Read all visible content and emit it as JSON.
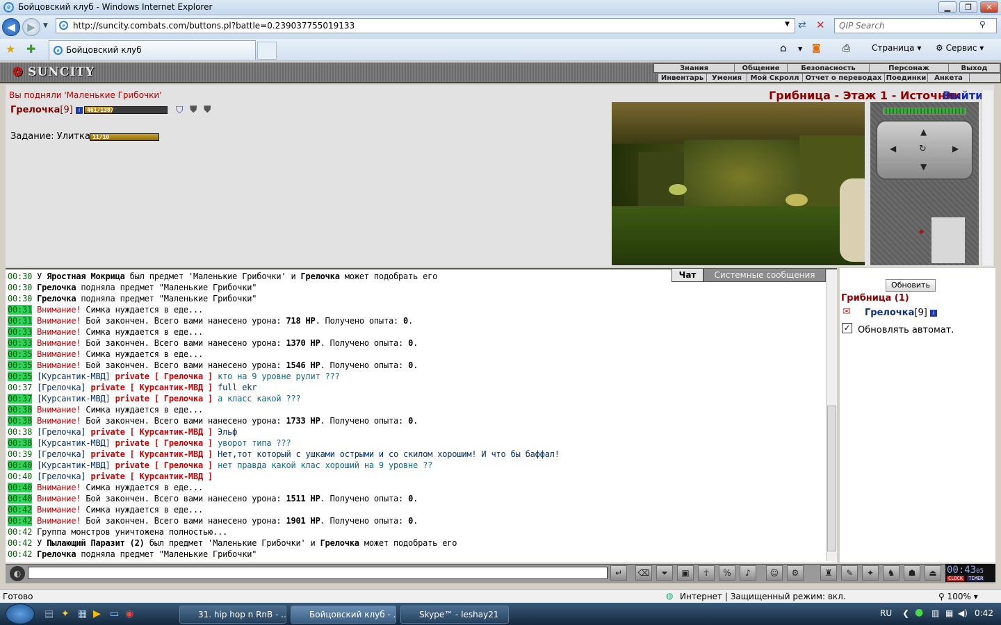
{
  "window": {
    "title": "Бойцовский клуб - Windows Internet Explorer"
  },
  "browser": {
    "url": "http://suncity.combats.com/buttons.pl?battle=0.239037755019133",
    "search_placeholder": "QIP Search",
    "tab_title": "Бойцовский клуб",
    "cmd_page": "Страница",
    "cmd_service": "Сервис",
    "status": "Готово",
    "zone": "Интернет | Защищенный режим: вкл.",
    "zoom": "100%"
  },
  "game": {
    "logo": "SUNCITY",
    "menu_top": [
      "Знания",
      "Общение",
      "Безопасность",
      "Персонаж",
      "Выход"
    ],
    "menu_bottom": [
      "Инвентарь",
      "Умения",
      "Мой Скролл",
      "Отчет о переводах",
      "Поединки",
      "Анкета"
    ],
    "notice": "Вы подняли 'Маленькие Грибочки'",
    "player": {
      "name": "Грелочка",
      "level": "[9]",
      "hp": "461/1387",
      "hp_fraction": 0.33
    },
    "quest": {
      "label": "Задание: Улитка",
      "progress": "11/10",
      "fraction": 1.0
    },
    "location": "Грибница - Этаж 1 - Источник",
    "exit": "Выйти"
  },
  "chat": {
    "tabs": [
      "Чат",
      "Системные сообщения"
    ],
    "lines": [
      {
        "t": "00:30",
        "hl": false,
        "parts": [
          [
            "n",
            "У "
          ],
          [
            "b",
            "Яростная Мокрица"
          ],
          [
            "n",
            " был предмет 'Маленькие Грибочки' и "
          ],
          [
            "b",
            "Грелочка"
          ],
          [
            "n",
            " может подобрать его"
          ]
        ]
      },
      {
        "t": "00:30",
        "hl": false,
        "parts": [
          [
            "b",
            "Грелочка"
          ],
          [
            "n",
            " подняла предмет \"Маленькие Грибочки\""
          ]
        ]
      },
      {
        "t": "00:30",
        "hl": false,
        "parts": [
          [
            "b",
            "Грелочка"
          ],
          [
            "n",
            " подняла предмет \"Маленькие Грибочки\""
          ]
        ]
      },
      {
        "t": "00:31",
        "hl": true,
        "parts": [
          [
            "w",
            "Внимание!"
          ],
          [
            "n",
            " Симка нуждается в еде..."
          ]
        ]
      },
      {
        "t": "00:31",
        "hl": true,
        "parts": [
          [
            "w",
            "Внимание!"
          ],
          [
            "n",
            " Бой закончен. Всего вами нанесено урона: "
          ],
          [
            "b",
            "718 HP"
          ],
          [
            "n",
            ". Получено опыта: "
          ],
          [
            "b",
            "0"
          ],
          [
            "n",
            "."
          ]
        ]
      },
      {
        "t": "00:33",
        "hl": true,
        "parts": [
          [
            "w",
            "Внимание!"
          ],
          [
            "n",
            " Симка нуждается в еде..."
          ]
        ]
      },
      {
        "t": "00:33",
        "hl": true,
        "parts": [
          [
            "w",
            "Внимание!"
          ],
          [
            "n",
            " Бой закончен. Всего вами нанесено урона: "
          ],
          [
            "b",
            "1370 HP"
          ],
          [
            "n",
            ". Получено опыта: "
          ],
          [
            "b",
            "0"
          ],
          [
            "n",
            "."
          ]
        ]
      },
      {
        "t": "00:35",
        "hl": true,
        "parts": [
          [
            "w",
            "Внимание!"
          ],
          [
            "n",
            " Симка нуждается в еде..."
          ]
        ]
      },
      {
        "t": "00:35",
        "hl": true,
        "parts": [
          [
            "w",
            "Внимание!"
          ],
          [
            "n",
            " Бой закончен. Всего вами нанесено урона: "
          ],
          [
            "b",
            "1546 HP"
          ],
          [
            "n",
            ". Получено опыта: "
          ],
          [
            "b",
            "0"
          ],
          [
            "n",
            "."
          ]
        ]
      },
      {
        "t": "00:35",
        "hl": true,
        "parts": [
          [
            "k",
            "[Курсантик-МВД]"
          ],
          [
            "n",
            " "
          ],
          [
            "p",
            "private [ Грелочка ]"
          ],
          [
            "n",
            " "
          ],
          [
            "m",
            "кто на 9 уровне рулит ???"
          ]
        ]
      },
      {
        "t": "00:37",
        "hl": false,
        "parts": [
          [
            "k",
            "[Грелочка]"
          ],
          [
            "n",
            " "
          ],
          [
            "p",
            "private [ Курсантик-МВД ]"
          ],
          [
            "n",
            " "
          ],
          [
            "k",
            "full ekr"
          ]
        ]
      },
      {
        "t": "00:37",
        "hl": true,
        "parts": [
          [
            "k",
            "[Курсантик-МВД]"
          ],
          [
            "n",
            " "
          ],
          [
            "p",
            "private [ Грелочка ]"
          ],
          [
            "n",
            " "
          ],
          [
            "m",
            "а класс какой ???"
          ]
        ]
      },
      {
        "t": "00:38",
        "hl": true,
        "parts": [
          [
            "w",
            "Внимание!"
          ],
          [
            "n",
            " Симка нуждается в еде..."
          ]
        ]
      },
      {
        "t": "00:38",
        "hl": true,
        "parts": [
          [
            "w",
            "Внимание!"
          ],
          [
            "n",
            " Бой закончен. Всего вами нанесено урона: "
          ],
          [
            "b",
            "1733 HP"
          ],
          [
            "n",
            ". Получено опыта: "
          ],
          [
            "b",
            "0"
          ],
          [
            "n",
            "."
          ]
        ]
      },
      {
        "t": "00:38",
        "hl": false,
        "parts": [
          [
            "k",
            "[Грелочка]"
          ],
          [
            "n",
            " "
          ],
          [
            "p",
            "private [ Курсантик-МВД ]"
          ],
          [
            "n",
            " "
          ],
          [
            "k",
            "Эльф"
          ]
        ]
      },
      {
        "t": "00:38",
        "hl": true,
        "parts": [
          [
            "k",
            "[Курсантик-МВД]"
          ],
          [
            "n",
            " "
          ],
          [
            "p",
            "private [ Грелочка ]"
          ],
          [
            "n",
            " "
          ],
          [
            "m",
            "уворот типа ???"
          ]
        ]
      },
      {
        "t": "00:39",
        "hl": false,
        "parts": [
          [
            "k",
            "[Грелочка]"
          ],
          [
            "n",
            " "
          ],
          [
            "p",
            "private [ Курсантик-МВД ]"
          ],
          [
            "n",
            " "
          ],
          [
            "k",
            "Нет,тот который с ушками острыми и со скилом хорошим! И что бы баффал!"
          ]
        ]
      },
      {
        "t": "00:40",
        "hl": true,
        "parts": [
          [
            "k",
            "[Курсантик-МВД]"
          ],
          [
            "n",
            " "
          ],
          [
            "p",
            "private [ Грелочка ]"
          ],
          [
            "n",
            " "
          ],
          [
            "m",
            "нет правда какой клас хороший на 9 уровне ??"
          ]
        ]
      },
      {
        "t": "00:40",
        "hl": false,
        "parts": [
          [
            "k",
            "[Грелочка]"
          ],
          [
            "n",
            " "
          ],
          [
            "p",
            "private [ Курсантик-МВД ]"
          ]
        ]
      },
      {
        "t": "00:40",
        "hl": true,
        "parts": [
          [
            "w",
            "Внимание!"
          ],
          [
            "n",
            " Симка нуждается в еде..."
          ]
        ]
      },
      {
        "t": "00:40",
        "hl": true,
        "parts": [
          [
            "w",
            "Внимание!"
          ],
          [
            "n",
            " Бой закончен. Всего вами нанесено урона: "
          ],
          [
            "b",
            "1511 HP"
          ],
          [
            "n",
            ". Получено опыта: "
          ],
          [
            "b",
            "0"
          ],
          [
            "n",
            "."
          ]
        ]
      },
      {
        "t": "00:42",
        "hl": true,
        "parts": [
          [
            "w",
            "Внимание!"
          ],
          [
            "n",
            " Симка нуждается в еде..."
          ]
        ]
      },
      {
        "t": "00:42",
        "hl": true,
        "parts": [
          [
            "w",
            "Внимание!"
          ],
          [
            "n",
            " Бой закончен. Всего вами нанесено урона: "
          ],
          [
            "b",
            "1901 HP"
          ],
          [
            "n",
            ". Получено опыта: "
          ],
          [
            "b",
            "0"
          ],
          [
            "n",
            "."
          ]
        ]
      },
      {
        "t": "00:42",
        "hl": false,
        "parts": [
          [
            "n",
            "Группа монстров уничтожена полностью..."
          ]
        ]
      },
      {
        "t": "00:42",
        "hl": false,
        "parts": [
          [
            "n",
            "У "
          ],
          [
            "b",
            "Пылающий Паразит (2)"
          ],
          [
            "n",
            " был предмет 'Маленькие Грибочки' и "
          ],
          [
            "b",
            "Грелочка"
          ],
          [
            "n",
            " может подобрать его"
          ]
        ]
      },
      {
        "t": "00:42",
        "hl": false,
        "parts": [
          [
            "b",
            "Грелочка"
          ],
          [
            "n",
            " подняла предмет \"Маленькие Грибочки\""
          ]
        ]
      }
    ]
  },
  "room": {
    "refresh_button": "Обновить",
    "title": "Грибница (1)",
    "member_name": "Грелочка",
    "member_level": "[9]",
    "auto_refresh_label": "Обновлять автомат.",
    "auto_refresh_checked": true
  },
  "clock": {
    "time": "00:43",
    "seconds": "05",
    "label1": "CLOCK",
    "label2": "TIMER"
  },
  "taskbar": {
    "items": [
      "31. hip hop n RnB - ...",
      "Бойцовский клуб - ...",
      "Skype™ - leshay21"
    ],
    "lang": "RU",
    "time": "0:42"
  }
}
